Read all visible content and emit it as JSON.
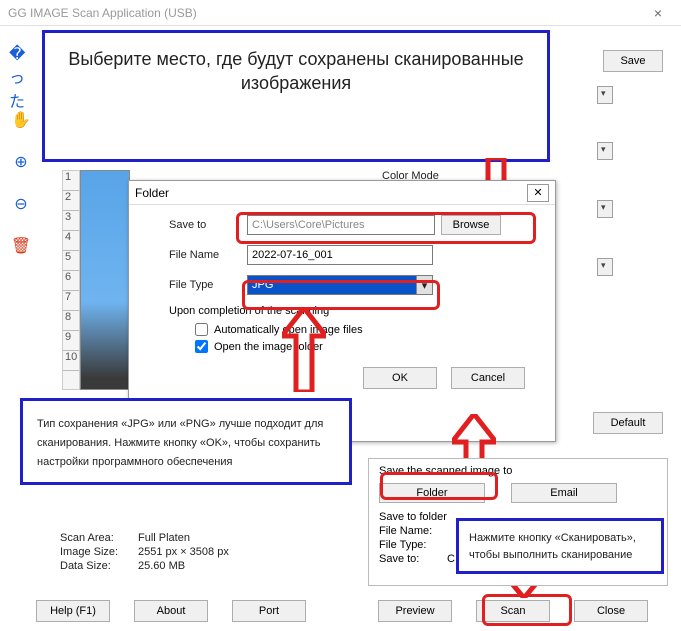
{
  "window": {
    "title": "GG IMAGE Scan Application (USB)"
  },
  "toolbar": {
    "save": "Save",
    "default": "Default"
  },
  "tools": [
    "crop",
    "hand",
    "zoom-in",
    "zoom-out",
    "trash"
  ],
  "labels": {
    "color_mode": "Color Mode"
  },
  "callouts": {
    "c1": "Выберите место, где будут сохранены сканированные изображения",
    "c2": "Тип сохранения «JPG» или «PNG» лучше подходит для сканирования. Нажмите кнопку «OK», чтобы сохранить настройки программного обеспечения",
    "c3": "Нажмите кнопку «Сканировать», чтобы выполнить сканирование"
  },
  "folder_dialog": {
    "title": "Folder",
    "save_to_label": "Save to",
    "save_to_value": "C:\\Users\\Core\\Pictures",
    "browse": "Browse",
    "file_name_label": "File Name",
    "file_name_value": "2022-07-16_001",
    "file_type_label": "File Type",
    "file_type_value": "JPG",
    "upon_completion": "Upon completion of the scanning",
    "auto_open_files": "Automatically open image files",
    "open_folder": "Open the image folder",
    "ok": "OK",
    "cancel": "Cancel"
  },
  "save_panel": {
    "title": "Save the scanned image to",
    "folder_btn": "Folder",
    "email_btn": "Email",
    "save_to_folder": "Save to folder",
    "file_name_label": "File Name:",
    "file_type_label": "File Type:",
    "save_to_label": "Save to:",
    "save_to_value": "C:\\Users\\Core\\Pictures"
  },
  "info": {
    "scan_area_label": "Scan Area:",
    "scan_area_value": "Full Platen",
    "image_size_label": "Image Size:",
    "image_size_value": "2551 px × 3508 px",
    "data_size_label": "Data Size:",
    "data_size_value": "25.60 MB"
  },
  "bottom": {
    "help": "Help (F1)",
    "about": "About",
    "port": "Port",
    "preview": "Preview",
    "scan": "Scan",
    "close": "Close"
  }
}
